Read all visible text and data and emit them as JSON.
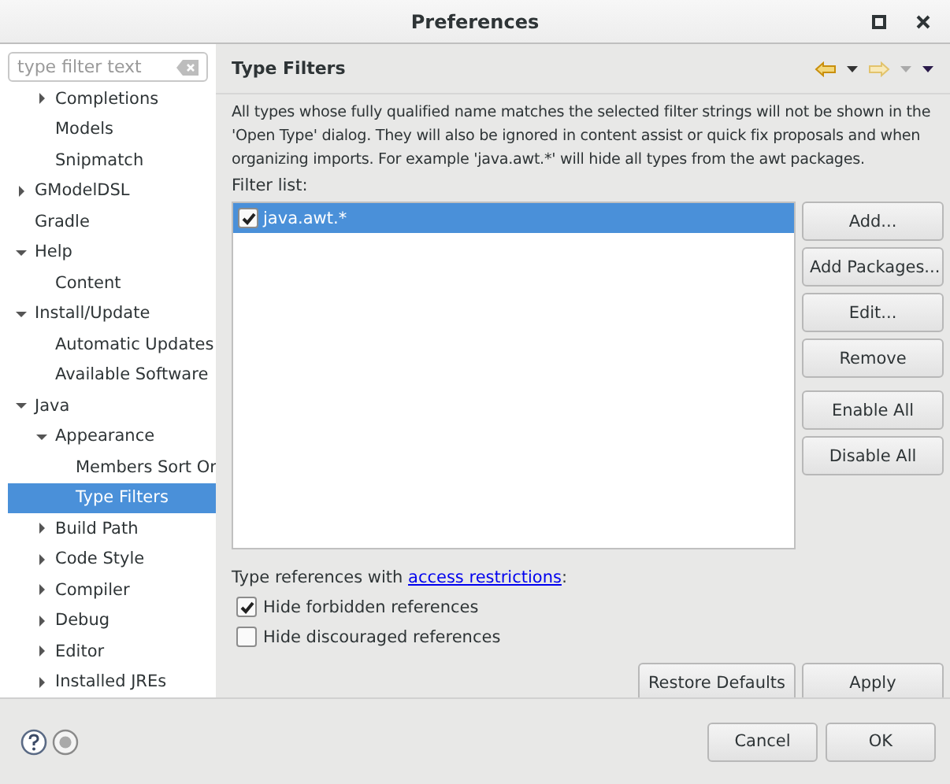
{
  "window": {
    "title": "Preferences"
  },
  "sidebar": {
    "filter": {
      "placeholder": "type filter text"
    },
    "tree": [
      {
        "children": [
          {
            "label": "Completions",
            "expanded": false,
            "selected": false
          },
          {
            "label": "Models",
            "selected": false
          },
          {
            "label": "Snipmatch",
            "selected": false
          }
        ]
      },
      {
        "label": "GModelDSL",
        "expanded": false,
        "selected": false
      },
      {
        "label": "Gradle",
        "selected": false
      },
      {
        "label": "Help",
        "expanded": true,
        "selected": false,
        "children": [
          {
            "label": "Content",
            "selected": false
          }
        ]
      },
      {
        "label": "Install/Update",
        "expanded": true,
        "selected": false,
        "children": [
          {
            "label": "Automatic Updates",
            "selected": false
          },
          {
            "label": "Available Software",
            "selected": false
          }
        ]
      },
      {
        "label": "Java",
        "expanded": true,
        "selected": false,
        "children": [
          {
            "label": "Appearance",
            "expanded": true,
            "selected": false,
            "children": [
              {
                "label": "Members Sort Or",
                "selected": false
              },
              {
                "label": "Type Filters",
                "selected": true
              }
            ]
          },
          {
            "label": "Build Path",
            "expanded": false,
            "selected": false
          },
          {
            "label": "Code Style",
            "expanded": false,
            "selected": false
          },
          {
            "label": "Compiler",
            "expanded": false,
            "selected": false
          },
          {
            "label": "Debug",
            "expanded": false,
            "selected": false
          },
          {
            "label": "Editor",
            "expanded": false,
            "selected": false
          },
          {
            "label": "Installed JREs",
            "expanded": false,
            "selected": false
          }
        ]
      }
    ]
  },
  "page": {
    "title": "Type Filters",
    "description": "All types whose fully qualified name matches the selected filter strings will not be shown in the 'Open Type' dialog. They will also be ignored in content assist or quick fix proposals and when organizing imports. For example 'java.awt.*' will hide all types from the awt packages.",
    "filter_list_label": "Filter list:",
    "filters": [
      {
        "text": "java.awt.*",
        "checked": true,
        "selected": true
      }
    ],
    "button_groups": [
      [
        "Add...",
        "Add Packages...",
        "Edit...",
        "Remove"
      ],
      [
        "Enable All",
        "Disable All"
      ]
    ],
    "access_text": "Type references with ",
    "access_link": "access restrictions",
    "access_suffix": ":",
    "options": [
      {
        "label": "Hide forbidden references",
        "checked": true
      },
      {
        "label": "Hide discouraged references",
        "checked": false
      }
    ],
    "page_buttons": [
      "Restore Defaults",
      "Apply"
    ]
  },
  "footer": {
    "buttons": [
      "Cancel",
      "OK"
    ]
  }
}
